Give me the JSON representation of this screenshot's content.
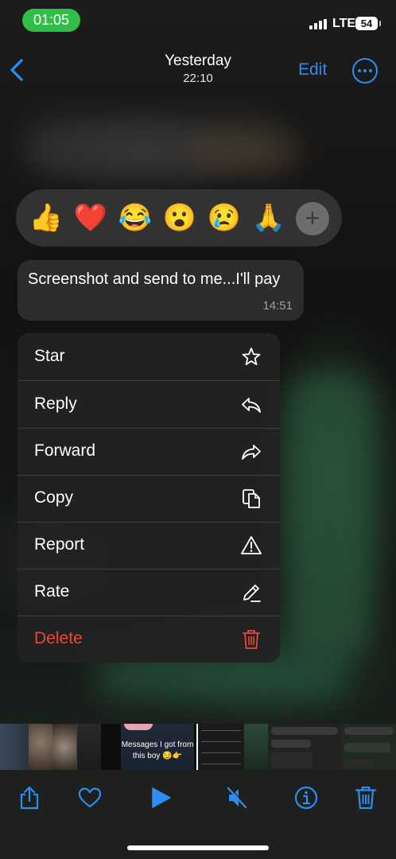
{
  "status_bar": {
    "time": "01:05",
    "network": "LTE",
    "battery": "54",
    "accent_color": "#2fbf47"
  },
  "nav": {
    "title": "Yesterday",
    "subtitle": "22:10",
    "edit_label": "Edit",
    "back_icon": "chevron-left-icon",
    "more_icon": "ellipsis-circle-icon",
    "accent_color": "#2e8df2"
  },
  "reactions": {
    "emojis": [
      "👍",
      "❤️",
      "😂",
      "😮",
      "😢",
      "🙏"
    ],
    "more_label": "+"
  },
  "message": {
    "text": "Screenshot and send to me...I'll pay",
    "time": "14:51"
  },
  "menu": {
    "items": [
      {
        "label": "Star",
        "icon": "star-icon"
      },
      {
        "label": "Reply",
        "icon": "reply-icon"
      },
      {
        "label": "Forward",
        "icon": "forward-icon"
      },
      {
        "label": "Copy",
        "icon": "copy-icon"
      },
      {
        "label": "Report",
        "icon": "warning-icon"
      },
      {
        "label": "Rate",
        "icon": "pencil-icon"
      },
      {
        "label": "Delete",
        "icon": "trash-icon"
      }
    ],
    "danger_color": "#e5483d"
  },
  "thumbnails": {
    "caption": "Messages I got from this boy 😏👉"
  },
  "toolbar": {
    "icons": [
      "share-icon",
      "heart-icon",
      "play-icon",
      "mute-icon",
      "info-icon",
      "trash-icon"
    ]
  }
}
